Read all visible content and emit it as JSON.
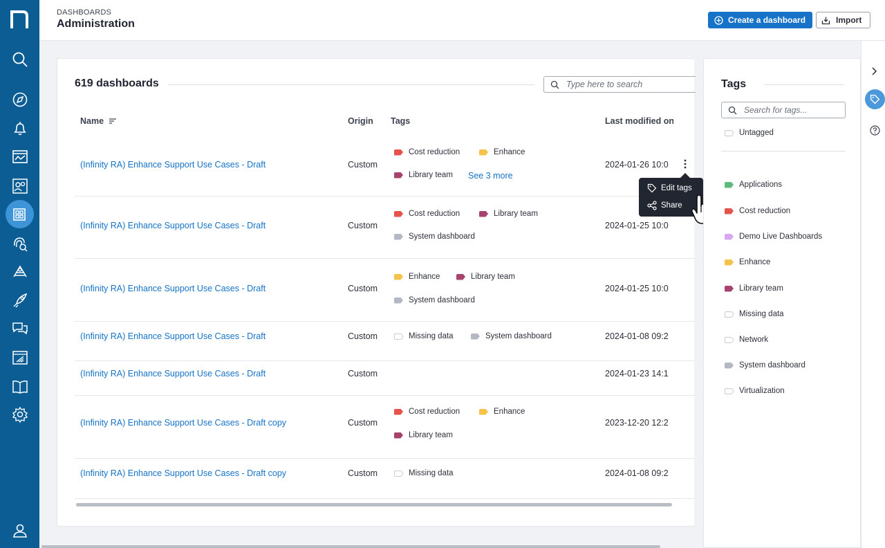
{
  "header": {
    "breadcrumb": "DASHBOARDS",
    "title": "Administration",
    "create_label": "Create a dashboard",
    "import_label": "Import"
  },
  "nav": {
    "icons": [
      "logo-icon",
      "search-icon",
      "compass-icon",
      "bell-icon",
      "monitor-chart-icon",
      "users-icon",
      "dashboards-icon",
      "fingerprint-search-icon",
      "deploy-icon",
      "rocket-icon",
      "chat-icon",
      "report-icon",
      "book-icon",
      "settings-icon",
      "user-icon"
    ],
    "active": "dashboards-icon"
  },
  "main": {
    "count": "619 dashboards",
    "search_placeholder": "Type here to search",
    "columns": {
      "name": "Name",
      "origin": "Origin",
      "tags": "Tags",
      "modified": "Last modified on"
    },
    "rows": [
      {
        "name": "(Infinity RA) Enhance Support Use Cases - Draft",
        "origin": "Custom",
        "tags": [
          "Cost reduction",
          "Enhance",
          "Library team"
        ],
        "more": "See 3 more",
        "modified": "2024-01-26 10:0"
      },
      {
        "name": "(Infinity RA) Enhance Support Use Cases - Draft",
        "origin": "Custom",
        "tags": [
          "Cost reduction",
          "Library team",
          "System dashboard"
        ],
        "modified": "2024-01-25 10:0"
      },
      {
        "name": "(Infinity RA) Enhance Support Use Cases - Draft",
        "origin": "Custom",
        "tags": [
          "Enhance",
          "Library team",
          "System dashboard"
        ],
        "modified": "2024-01-25 10:0"
      },
      {
        "name": "(Infinity RA) Enhance Support Use Cases - Draft",
        "origin": "Custom",
        "tags": [
          "Missing data",
          "System dashboard"
        ],
        "modified": "2024-01-08 09:2"
      },
      {
        "name": "(Infinity RA) Enhance Support Use Cases - Draft",
        "origin": "Custom",
        "tags": [],
        "modified": "2024-01-23 14:1"
      },
      {
        "name": "(Infinity RA) Enhance Support Use Cases - Draft copy",
        "origin": "Custom",
        "tags": [
          "Cost reduction",
          "Enhance",
          "Library team"
        ],
        "modified": "2023-12-20 12:2"
      },
      {
        "name": "(Infinity RA) Enhance Support Use Cases - Draft copy",
        "origin": "Custom",
        "tags": [
          "Missing data"
        ],
        "modified": "2024-01-08 09:2"
      }
    ],
    "context_menu": {
      "edit_tags": "Edit tags",
      "share": "Share"
    }
  },
  "tags_panel": {
    "title": "Tags",
    "search_placeholder": "Search for tags...",
    "untagged": "Untagged",
    "items": [
      "Applications",
      "Cost reduction",
      "Demo Live Dashboards",
      "Enhance",
      "Library team",
      "Missing data",
      "Network",
      "System dashboard",
      "Virtualization"
    ]
  },
  "tag_colors": {
    "Applications": "#5fba7d",
    "Cost reduction": "#e5534b",
    "Demo Live Dashboards": "#d7a7f0",
    "Enhance": "#f6c34a",
    "Library team": "#a6436f",
    "Missing data": "",
    "Network": "",
    "System dashboard": "#b3b8c2",
    "Virtualization": "",
    "Untagged": ""
  },
  "colors": {
    "nav_bg": "#0b5d94",
    "accent": "#1673c7",
    "menu_bg": "#222630"
  }
}
